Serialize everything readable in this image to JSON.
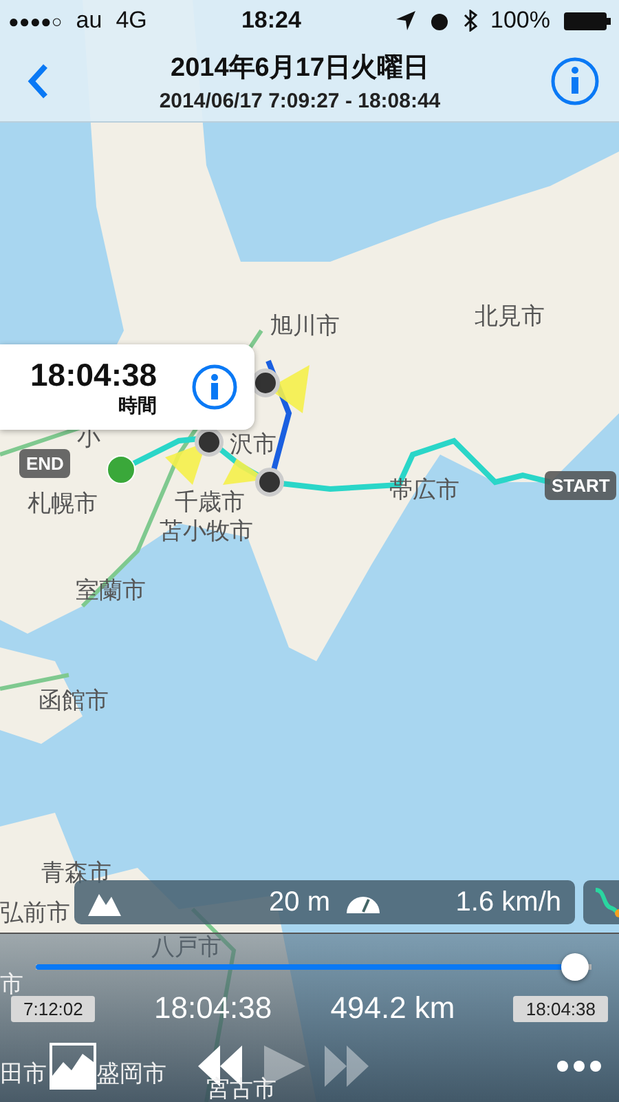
{
  "status_bar": {
    "signal_dots": "●●●●○",
    "carrier": "au",
    "network": "4G",
    "time": "18:24",
    "battery": "100%"
  },
  "nav": {
    "title": "2014年6月17日火曜日",
    "subtitle": "2014/06/17 7:09:27 - 18:08:44"
  },
  "map": {
    "places": [
      "旭川市",
      "北見市",
      "小",
      "沢市",
      "札幌市",
      "帯広市",
      "千歳市",
      "苫小牧市",
      "室蘭市",
      "函館市",
      "青森市",
      "弘前市",
      "八戸市",
      "市",
      "田市",
      "盛岡市",
      "宮古市"
    ],
    "start_label": "START",
    "end_label": "END",
    "callout": {
      "time": "18:04:38",
      "label": "時間"
    }
  },
  "stats": {
    "altitude": "20 m",
    "speed": "1.6 km/h"
  },
  "player": {
    "level": 0.97,
    "start_time": "7:12:02",
    "current_time": "18:04:38",
    "distance": "494.2 km",
    "end_time": "18:04:38",
    "controls": [
      {
        "kind": "rewind",
        "disabled": false
      },
      {
        "kind": "play",
        "disabled": true
      },
      {
        "kind": "forward",
        "disabled": true
      }
    ]
  }
}
